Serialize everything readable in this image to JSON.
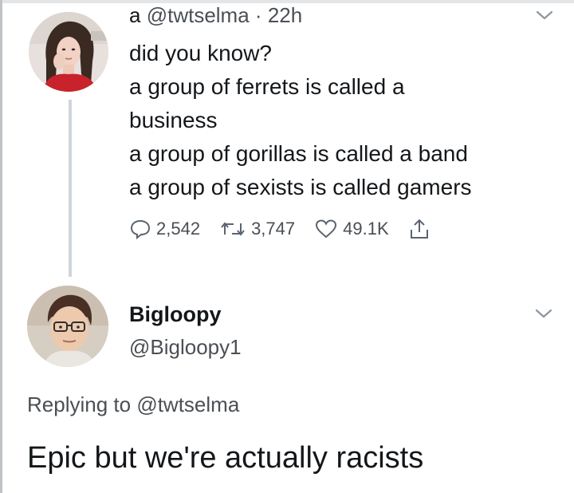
{
  "original_tweet": {
    "display_name": "a",
    "handle": "@twtselma",
    "separator": "·",
    "time": "22h",
    "lines": [
      "did you know?",
      "a group of ferrets is called a",
      "business",
      "a group of gorillas is called a band",
      "a group of sexists is called gamers"
    ],
    "stats": {
      "replies": "2,542",
      "retweets": "3,747",
      "likes": "49.1K"
    },
    "icons": [
      "reply-icon",
      "retweet-icon",
      "like-icon",
      "share-icon",
      "chevron-down-icon"
    ]
  },
  "reply_tweet": {
    "display_name": "Bigloopy",
    "handle": "@Bigloopy1",
    "replying_prefix": "Replying to",
    "replying_to": "@twtselma",
    "text": "Epic but we're actually racists"
  },
  "colors": {
    "text_primary": "#14171a",
    "text_secondary": "#4a4f55",
    "thread_line": "#cfd5da"
  }
}
